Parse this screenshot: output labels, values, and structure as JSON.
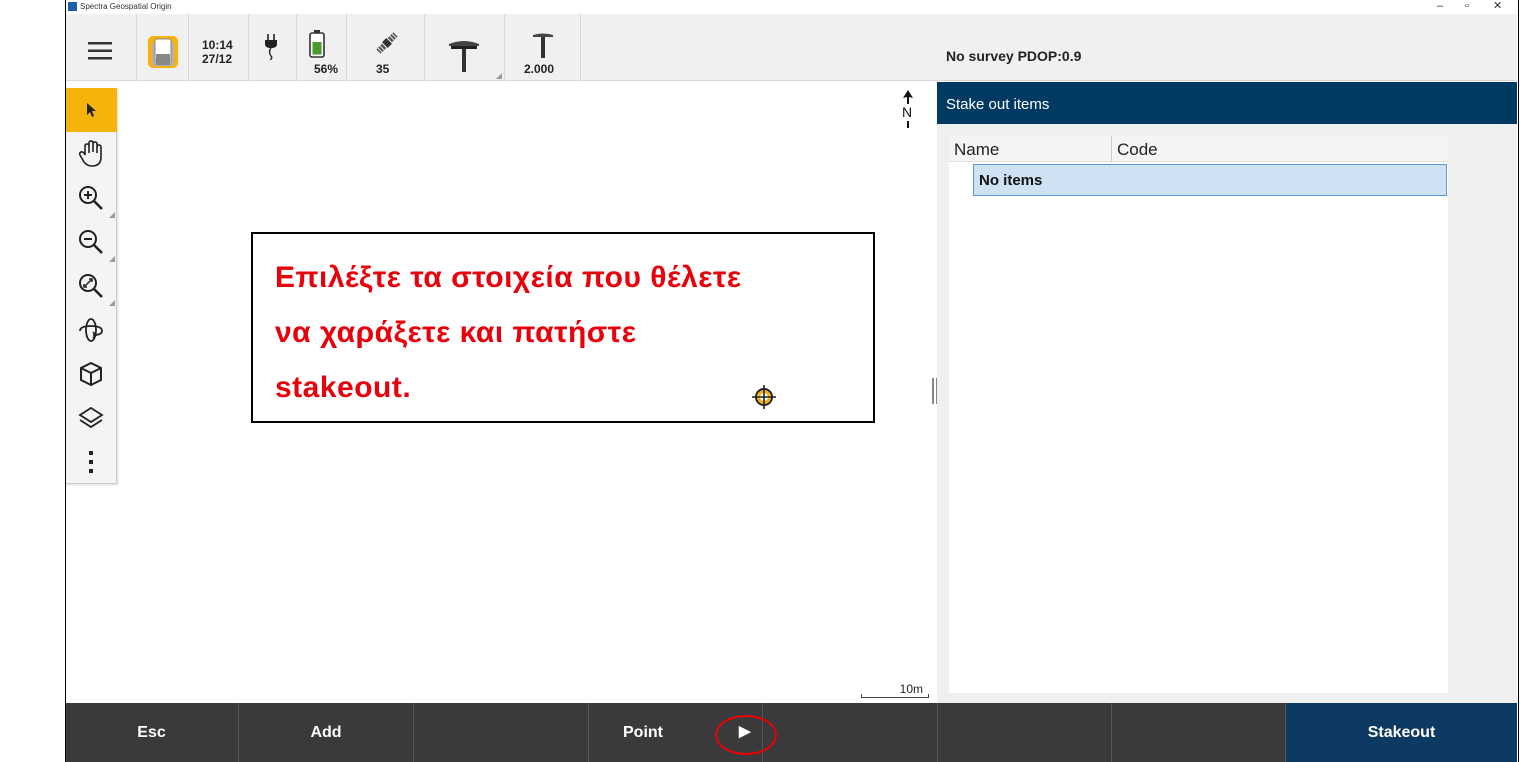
{
  "window": {
    "title": "Spectra Geospatial Origin",
    "controls": [
      "–",
      "▫",
      "✕"
    ]
  },
  "statusbar": {
    "time": "10:14",
    "date": "27/12",
    "battery": "56%",
    "satellites": "35",
    "antenna_height": "2.000",
    "survey_status": "No survey  PDOP:0.9"
  },
  "toolbar": {
    "active_tool": "select",
    "tools": [
      "select",
      "pan",
      "zoom-in",
      "zoom-out",
      "zoom-extents",
      "orbit",
      "3d-view",
      "layers",
      "more"
    ]
  },
  "map": {
    "annotation_lines": [
      "Επιλέξτε τα στοιχεία που θέλετε",
      "να χαράξετε και πατήστε",
      "stakeout."
    ],
    "north_label": "N",
    "scale_label": "10m",
    "annotation_color": "#e8000b"
  },
  "panel": {
    "title": "Stake out items",
    "columns": [
      "Name",
      "Code"
    ],
    "empty_text": "No items",
    "header_color": "#003a63"
  },
  "bottombar": {
    "buttons": [
      "Esc",
      "Add",
      "",
      "Point",
      "",
      "",
      "",
      "Stakeout"
    ],
    "point_arrow": "▶",
    "highlight_color": "#0c3a63"
  }
}
